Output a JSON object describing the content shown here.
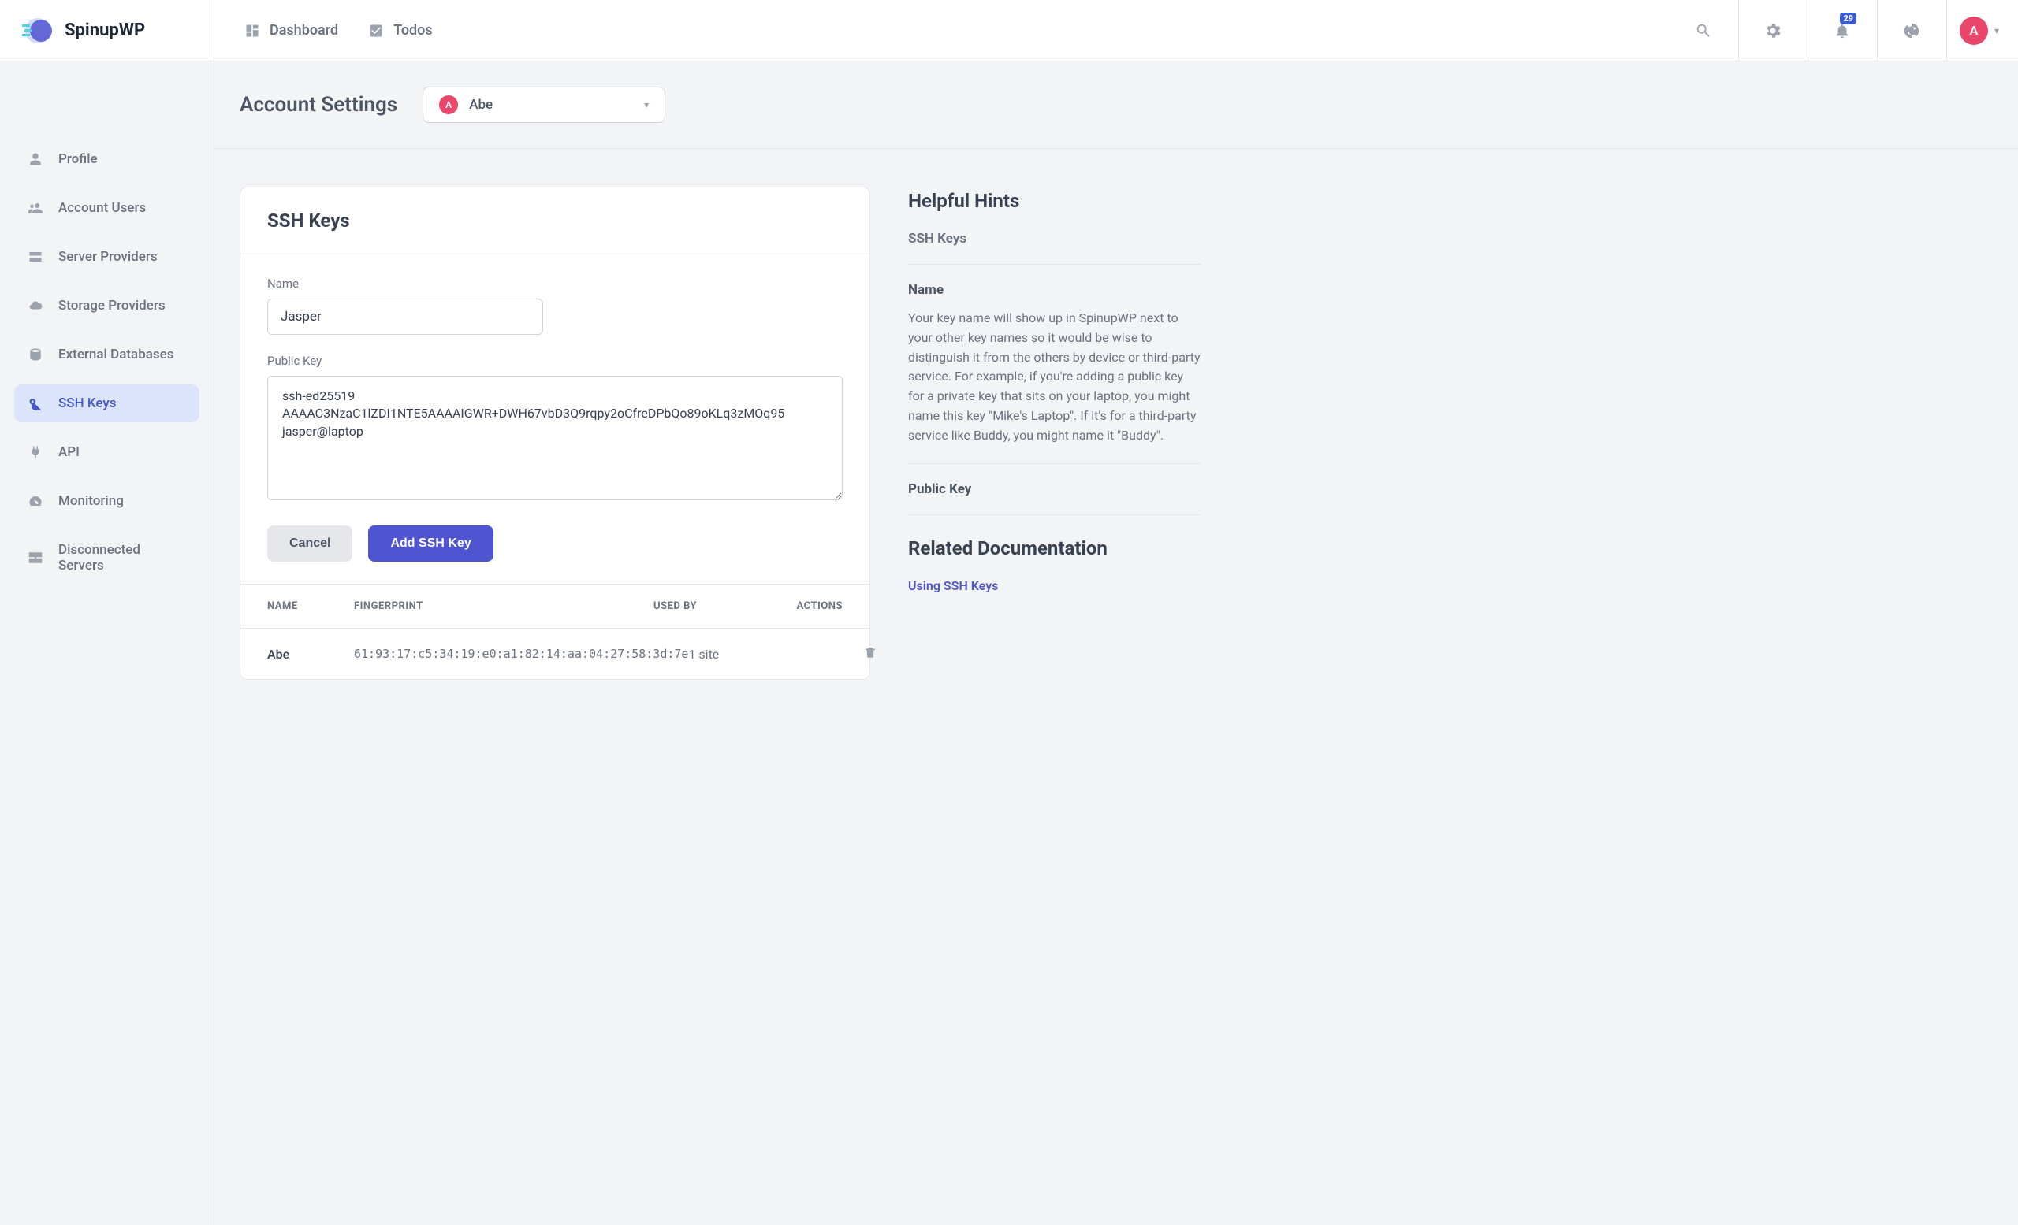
{
  "brand": {
    "name": "SpinupWP"
  },
  "nav": {
    "dashboard": "Dashboard",
    "todos": "Todos"
  },
  "header": {
    "notif_count": "29",
    "avatar_initial": "A"
  },
  "sidebar": {
    "items": [
      {
        "label": "Profile"
      },
      {
        "label": "Account Users"
      },
      {
        "label": "Server Providers"
      },
      {
        "label": "Storage Providers"
      },
      {
        "label": "External Databases"
      },
      {
        "label": "SSH Keys"
      },
      {
        "label": "API"
      },
      {
        "label": "Monitoring"
      },
      {
        "label": "Disconnected Servers"
      }
    ]
  },
  "titlebar": {
    "title": "Account Settings",
    "account_initial": "A",
    "account_name": "Abe"
  },
  "card": {
    "title": "SSH Keys",
    "name_label": "Name",
    "name_value": "Jasper",
    "pubkey_label": "Public Key",
    "pubkey_value": "ssh-ed25519 AAAAC3NzaC1lZDI1NTE5AAAAIGWR+DWH67vbD3Q9rqpy2oCfreDPbQo89oKLq3zMOq95 jasper@laptop",
    "cancel": "Cancel",
    "submit": "Add SSH Key",
    "cols": {
      "name": "NAME",
      "fp": "FINGERPRINT",
      "used": "USED BY",
      "actions": "ACTIONS"
    },
    "rows": [
      {
        "name": "Abe",
        "fp": "61:93:17:c5:34:19:e0:a1:82:14:aa:04:27:58:3d:7e",
        "used": "1 site"
      }
    ]
  },
  "hints": {
    "title": "Helpful Hints",
    "subtitle": "SSH Keys",
    "name_heading": "Name",
    "name_text": "Your key name will show up in SpinupWP next to your other key names so it would be wise to distinguish it from the others by device or third-party service. For example, if you're adding a public key for a private key that sits on your laptop, you might name this key \"Mike's Laptop\". If it's for a third-party service like Buddy, you might name it \"Buddy\".",
    "pubkey_heading": "Public Key",
    "related_title": "Related Documentation",
    "related_link": "Using SSH Keys"
  }
}
